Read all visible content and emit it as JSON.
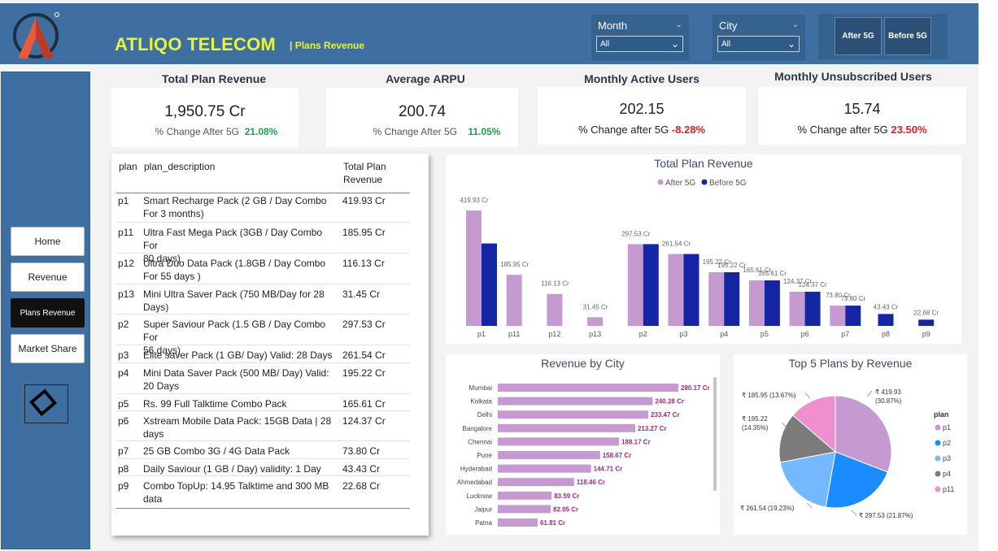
{
  "header": {
    "brand": "ATLIQO TELECOM",
    "subtitle": "| Plans Revenue"
  },
  "filters": {
    "month": {
      "label": "Month",
      "value": "All"
    },
    "city": {
      "label": "City",
      "value": "All"
    }
  },
  "toggles": {
    "after": "After 5G",
    "before": "Before 5G"
  },
  "nav": {
    "home": "Home",
    "revenue": "Revenue",
    "plans_revenue": "Plans Revenue",
    "market_share": "Market Share"
  },
  "kpis": [
    {
      "title": "Total Plan Revenue",
      "value": "1,950.75 Cr",
      "change_label": "% Change After 5G",
      "change": "21.08%"
    },
    {
      "title": "Average ARPU",
      "value": "200.74",
      "change_label": "% Change After 5G",
      "change": "11.05%"
    },
    {
      "title": "Monthly Active Users",
      "value": "202.15",
      "change_label": "% Change after 5G",
      "change": "-8.28%"
    },
    {
      "title": "Monthly Unsubscribed Users",
      "value": "15.74",
      "change_label": "% Change after 5G",
      "change": "23.50%"
    }
  ],
  "colors": {
    "after_5g": "#c59ad1",
    "before_5g": "#1426a4",
    "city_bar": "#c59ad1",
    "city_label": "#9d2a7a",
    "positive": "#1fa048",
    "negative": "#e01e1e",
    "topbar": "#3e6fa0",
    "brand_yellow": "#e7f43b"
  },
  "table": {
    "headers": {
      "plan": "plan",
      "desc": "plan_description",
      "rev1": "Total Plan",
      "rev2": "Revenue"
    },
    "rows": [
      {
        "plan": "p1",
        "d1": "Smart Recharge Pack (2 GB / Day Combo",
        "d2": "For 3 months)",
        "rev": "419.93 Cr"
      },
      {
        "plan": "p11",
        "d1": "Ultra Fast Mega Pack (3GB / Day Combo For",
        "d2": "80 days)",
        "rev": "185.95 Cr"
      },
      {
        "plan": "p12",
        "d1": "Ultra Duo Data Pack (1.8GB / Day Combo",
        "d2": "For 55 days )",
        "rev": "116.13 Cr"
      },
      {
        "plan": "p13",
        "d1": "Mini Ultra Saver Pack (750 MB/Day for 28",
        "d2": "Days)",
        "rev": "31.45 Cr"
      },
      {
        "plan": "p2",
        "d1": "Super Saviour Pack (1.5 GB / Day Combo For",
        "d2": "56 days)",
        "rev": "297.53 Cr"
      },
      {
        "plan": "p3",
        "d1": "Elite saver Pack (1 GB/ Day) Valid: 28 Days",
        "d2": "",
        "rev": "261.54 Cr"
      },
      {
        "plan": "p4",
        "d1": "Mini Data Saver Pack (500 MB/ Day) Valid:",
        "d2": "20 Days",
        "rev": "195.22 Cr"
      },
      {
        "plan": "p5",
        "d1": "Rs. 99 Full Talktime Combo Pack",
        "d2": "",
        "rev": "165.61 Cr"
      },
      {
        "plan": "p6",
        "d1": "Xstream Mobile Data Pack: 15GB Data | 28",
        "d2": "days",
        "rev": "124.37 Cr"
      },
      {
        "plan": "p7",
        "d1": "25 GB Combo 3G / 4G Data Pack",
        "d2": "",
        "rev": "73.80 Cr"
      },
      {
        "plan": "p8",
        "d1": "Daily Saviour (1 GB / Day) validity: 1 Day",
        "d2": "",
        "rev": "43.43 Cr"
      },
      {
        "plan": "p9",
        "d1": "Combo TopUp: 14.95 Talktime and 300 MB",
        "d2": "data",
        "rev": "22.68 Cr"
      }
    ]
  },
  "chart_data": [
    {
      "type": "bar",
      "title": "Total Plan Revenue",
      "categories": [
        "p1",
        "p11",
        "p12",
        "p13",
        "p2",
        "p3",
        "p4",
        "p5",
        "p6",
        "p7",
        "p8",
        "p9"
      ],
      "series": [
        {
          "name": "After 5G",
          "values": [
            419.93,
            185.95,
            116.13,
            31.45,
            297.53,
            261.54,
            195.22,
            165.61,
            124.37,
            73.8,
            null,
            null
          ],
          "labels": [
            "419.93 Cr",
            "185.95 Cr",
            "116.13 Cr",
            "31.45 Cr",
            "297.53 Cr",
            "261.54 Cr",
            "195.22 Cr",
            "165.61 Cr",
            "124.37 Cr",
            "73.80 Cr",
            "",
            ""
          ]
        },
        {
          "name": "Before 5G",
          "values": [
            300,
            null,
            null,
            null,
            297.53,
            261.54,
            195.22,
            165.61,
            124.37,
            73.8,
            43.43,
            22.68
          ],
          "labels": [
            "",
            "",
            "",
            "",
            "",
            "",
            "195.22 Cr",
            "165.61 Cr",
            "124.37 Cr",
            "73.80 Cr",
            "43.43 Cr",
            "22.68 Cr"
          ]
        }
      ],
      "legend": "top-center"
    },
    {
      "type": "bar",
      "orientation": "horizontal",
      "title": "Revenue by City",
      "categories": [
        "Mumbai",
        "Kolkata",
        "Delhi",
        "Bangalore",
        "Chennai",
        "Pune",
        "Hyderabad",
        "Ahmedabad",
        "Lucknow",
        "Jaipur",
        "Patna"
      ],
      "values": [
        280.17,
        240.28,
        233.47,
        213.27,
        188.17,
        158.67,
        144.71,
        118.46,
        83.59,
        82.05,
        61.81
      ],
      "labels": [
        "280.17 Cr",
        "240.28 Cr",
        "233.47 Cr",
        "213.27 Cr",
        "188.17 Cr",
        "158.67 Cr",
        "144.71 Cr",
        "118.46 Cr",
        "83.59 Cr",
        "82.05 Cr",
        "61.81 Cr"
      ]
    },
    {
      "type": "pie",
      "title": "Top 5 Plans by Revenue",
      "legend_title": "plan",
      "slices": [
        {
          "name": "p1",
          "value": 419.93,
          "label1": "₹ 419.93",
          "label2": "(30.87%)",
          "color": "#c59ad1"
        },
        {
          "name": "p2",
          "value": 297.53,
          "label1": "₹ 297.53 (21.87%)",
          "label2": "",
          "color": "#1a8cff"
        },
        {
          "name": "p3",
          "value": 261.54,
          "label1": "₹ 261.54 (19.23%)",
          "label2": "",
          "color": "#74b9ff"
        },
        {
          "name": "p4",
          "value": 195.22,
          "label1": "₹ 195.22",
          "label2": "(14.35%)",
          "color": "#7b7b7b"
        },
        {
          "name": "p11",
          "value": 185.95,
          "label1": "₹ 185.95 (13.67%)",
          "label2": "",
          "color": "#f08fd0"
        }
      ],
      "legend": "right"
    }
  ]
}
